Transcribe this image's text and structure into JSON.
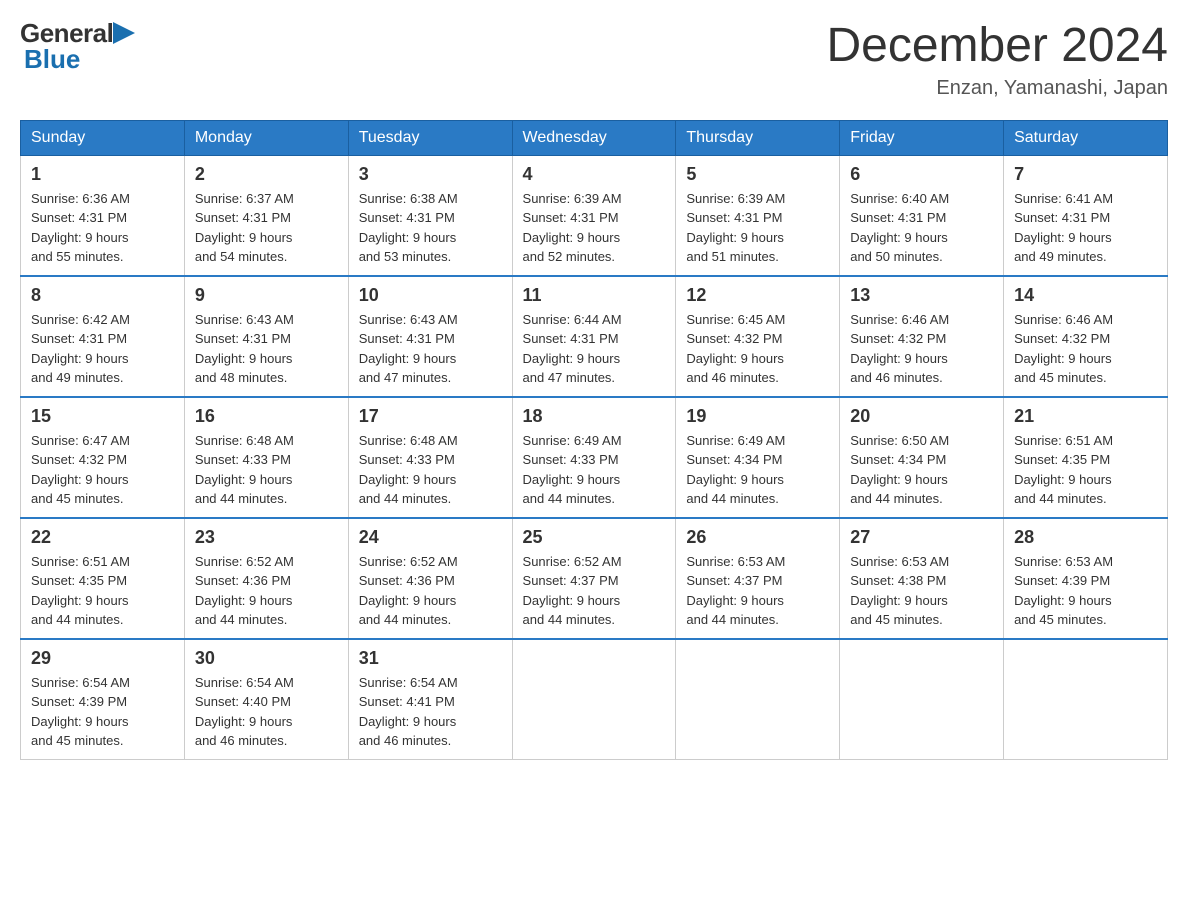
{
  "header": {
    "title": "December 2024",
    "location": "Enzan, Yamanashi, Japan",
    "logo_general": "General",
    "logo_blue": "Blue"
  },
  "weekdays": [
    "Sunday",
    "Monday",
    "Tuesday",
    "Wednesday",
    "Thursday",
    "Friday",
    "Saturday"
  ],
  "weeks": [
    [
      {
        "day": "1",
        "sunrise": "6:36 AM",
        "sunset": "4:31 PM",
        "daylight": "9 hours and 55 minutes."
      },
      {
        "day": "2",
        "sunrise": "6:37 AM",
        "sunset": "4:31 PM",
        "daylight": "9 hours and 54 minutes."
      },
      {
        "day": "3",
        "sunrise": "6:38 AM",
        "sunset": "4:31 PM",
        "daylight": "9 hours and 53 minutes."
      },
      {
        "day": "4",
        "sunrise": "6:39 AM",
        "sunset": "4:31 PM",
        "daylight": "9 hours and 52 minutes."
      },
      {
        "day": "5",
        "sunrise": "6:39 AM",
        "sunset": "4:31 PM",
        "daylight": "9 hours and 51 minutes."
      },
      {
        "day": "6",
        "sunrise": "6:40 AM",
        "sunset": "4:31 PM",
        "daylight": "9 hours and 50 minutes."
      },
      {
        "day": "7",
        "sunrise": "6:41 AM",
        "sunset": "4:31 PM",
        "daylight": "9 hours and 49 minutes."
      }
    ],
    [
      {
        "day": "8",
        "sunrise": "6:42 AM",
        "sunset": "4:31 PM",
        "daylight": "9 hours and 49 minutes."
      },
      {
        "day": "9",
        "sunrise": "6:43 AM",
        "sunset": "4:31 PM",
        "daylight": "9 hours and 48 minutes."
      },
      {
        "day": "10",
        "sunrise": "6:43 AM",
        "sunset": "4:31 PM",
        "daylight": "9 hours and 47 minutes."
      },
      {
        "day": "11",
        "sunrise": "6:44 AM",
        "sunset": "4:31 PM",
        "daylight": "9 hours and 47 minutes."
      },
      {
        "day": "12",
        "sunrise": "6:45 AM",
        "sunset": "4:32 PM",
        "daylight": "9 hours and 46 minutes."
      },
      {
        "day": "13",
        "sunrise": "6:46 AM",
        "sunset": "4:32 PM",
        "daylight": "9 hours and 46 minutes."
      },
      {
        "day": "14",
        "sunrise": "6:46 AM",
        "sunset": "4:32 PM",
        "daylight": "9 hours and 45 minutes."
      }
    ],
    [
      {
        "day": "15",
        "sunrise": "6:47 AM",
        "sunset": "4:32 PM",
        "daylight": "9 hours and 45 minutes."
      },
      {
        "day": "16",
        "sunrise": "6:48 AM",
        "sunset": "4:33 PM",
        "daylight": "9 hours and 44 minutes."
      },
      {
        "day": "17",
        "sunrise": "6:48 AM",
        "sunset": "4:33 PM",
        "daylight": "9 hours and 44 minutes."
      },
      {
        "day": "18",
        "sunrise": "6:49 AM",
        "sunset": "4:33 PM",
        "daylight": "9 hours and 44 minutes."
      },
      {
        "day": "19",
        "sunrise": "6:49 AM",
        "sunset": "4:34 PM",
        "daylight": "9 hours and 44 minutes."
      },
      {
        "day": "20",
        "sunrise": "6:50 AM",
        "sunset": "4:34 PM",
        "daylight": "9 hours and 44 minutes."
      },
      {
        "day": "21",
        "sunrise": "6:51 AM",
        "sunset": "4:35 PM",
        "daylight": "9 hours and 44 minutes."
      }
    ],
    [
      {
        "day": "22",
        "sunrise": "6:51 AM",
        "sunset": "4:35 PM",
        "daylight": "9 hours and 44 minutes."
      },
      {
        "day": "23",
        "sunrise": "6:52 AM",
        "sunset": "4:36 PM",
        "daylight": "9 hours and 44 minutes."
      },
      {
        "day": "24",
        "sunrise": "6:52 AM",
        "sunset": "4:36 PM",
        "daylight": "9 hours and 44 minutes."
      },
      {
        "day": "25",
        "sunrise": "6:52 AM",
        "sunset": "4:37 PM",
        "daylight": "9 hours and 44 minutes."
      },
      {
        "day": "26",
        "sunrise": "6:53 AM",
        "sunset": "4:37 PM",
        "daylight": "9 hours and 44 minutes."
      },
      {
        "day": "27",
        "sunrise": "6:53 AM",
        "sunset": "4:38 PM",
        "daylight": "9 hours and 45 minutes."
      },
      {
        "day": "28",
        "sunrise": "6:53 AM",
        "sunset": "4:39 PM",
        "daylight": "9 hours and 45 minutes."
      }
    ],
    [
      {
        "day": "29",
        "sunrise": "6:54 AM",
        "sunset": "4:39 PM",
        "daylight": "9 hours and 45 minutes."
      },
      {
        "day": "30",
        "sunrise": "6:54 AM",
        "sunset": "4:40 PM",
        "daylight": "9 hours and 46 minutes."
      },
      {
        "day": "31",
        "sunrise": "6:54 AM",
        "sunset": "4:41 PM",
        "daylight": "9 hours and 46 minutes."
      },
      null,
      null,
      null,
      null
    ]
  ],
  "labels": {
    "sunrise": "Sunrise:",
    "sunset": "Sunset:",
    "daylight": "Daylight:"
  }
}
